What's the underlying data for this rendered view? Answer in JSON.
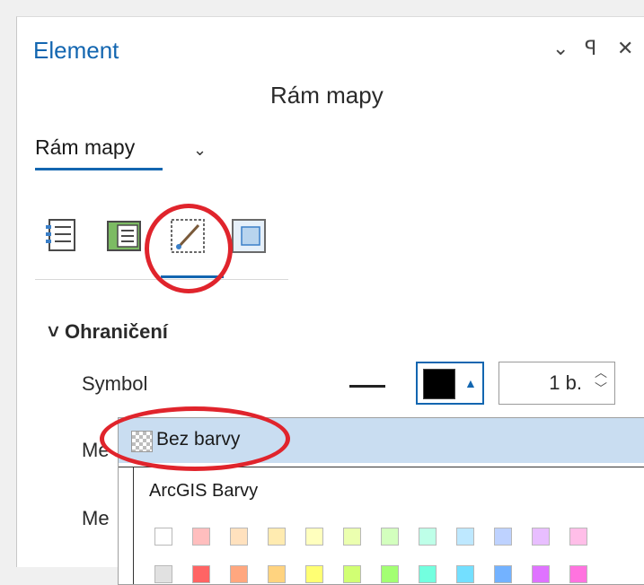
{
  "panel": {
    "title": "Element",
    "controls": {
      "options": "⌄",
      "pin": "ꟼ",
      "close": "✕"
    },
    "subtitle": "Rám mapy",
    "element_dropdown": {
      "label": "Rám mapy",
      "chevron": "⌄"
    }
  },
  "tabs": [
    {
      "name": "options-tab-icon"
    },
    {
      "name": "properties-tab-icon"
    },
    {
      "name": "display-tab-icon"
    },
    {
      "name": "placement-tab-icon"
    }
  ],
  "section": {
    "chevron": "˅",
    "title": "Ohraničení"
  },
  "rows": [
    {
      "label": "Symbol"
    },
    {
      "label": "Me"
    },
    {
      "label": "Me"
    }
  ],
  "color_button": {
    "color": "#000000",
    "arrow": "▲"
  },
  "size_spinner": {
    "value": "1 b."
  },
  "dropdown": {
    "no_color_label": "Bez barvy",
    "palette_title": "ArcGIS Barvy",
    "swatches_row1": [
      "#ffffff",
      "#ffbebe",
      "#ffe1be",
      "#ffebb0",
      "#ffffbe",
      "#ebffaf",
      "#d3ffbe",
      "#beffe8",
      "#bee8ff",
      "#bed2ff",
      "#e8beff",
      "#ffbee8"
    ],
    "swatches_row2": [
      "#e1e1e1",
      "#ff6464",
      "#ffa77f",
      "#ffd37f",
      "#ffff73",
      "#d1ff73",
      "#a3ff73",
      "#73ffdf",
      "#73dfff",
      "#73b2ff",
      "#df73ff",
      "#ff73df"
    ]
  },
  "highlight_color": "#e0242c",
  "accent_color": "#1366b0"
}
